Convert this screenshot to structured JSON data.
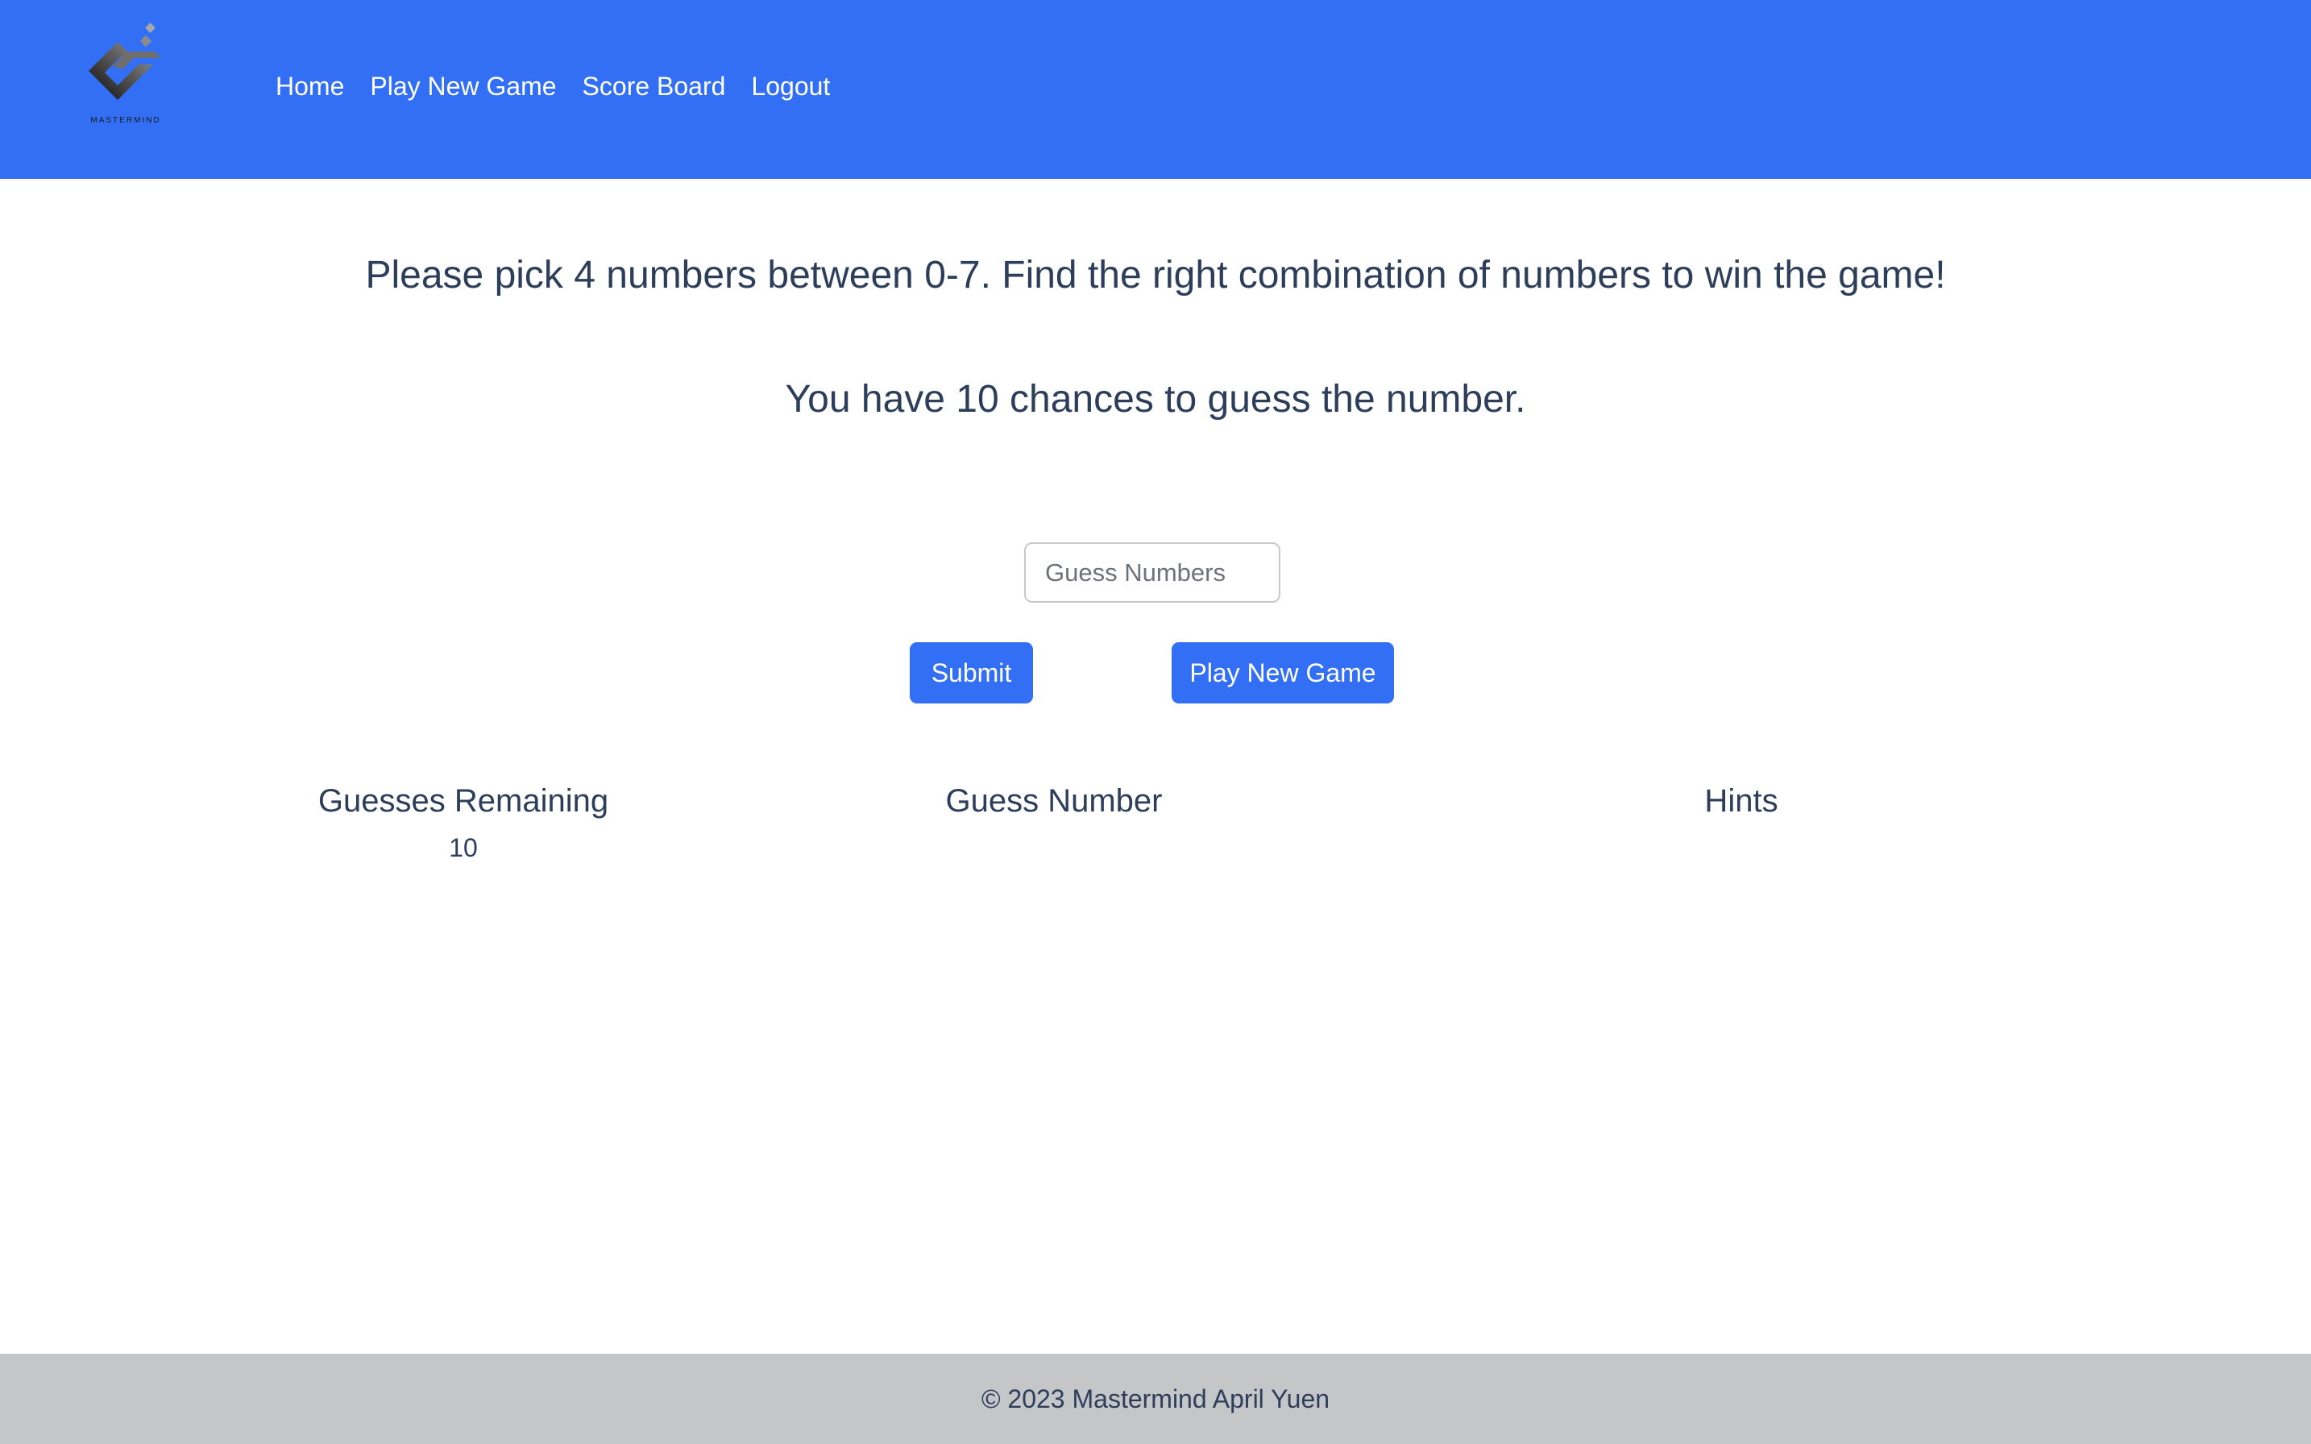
{
  "brand": {
    "logo_text": "MASTERMIND"
  },
  "nav": {
    "items": [
      "Home",
      "Play New Game",
      "Score Board",
      "Logout"
    ]
  },
  "main": {
    "intro_line_1": "Please pick 4 numbers between 0-7. Find the right combination of numbers to win the game!",
    "intro_line_2": "You have 10 chances to guess the number.",
    "guess_input": {
      "placeholder": "Guess Numbers",
      "value": ""
    },
    "submit_label": "Submit",
    "new_game_label": "Play New Game",
    "columns": {
      "remaining_header": "Guesses Remaining",
      "remaining_value": "10",
      "guess_header": "Guess Number",
      "hints_header": "Hints"
    }
  },
  "footer": {
    "text": "© 2023 Mastermind April Yuen"
  },
  "colors": {
    "primary": "#336ff5",
    "text": "#2c3e5a",
    "footer_bg": "#c5c6c8"
  }
}
